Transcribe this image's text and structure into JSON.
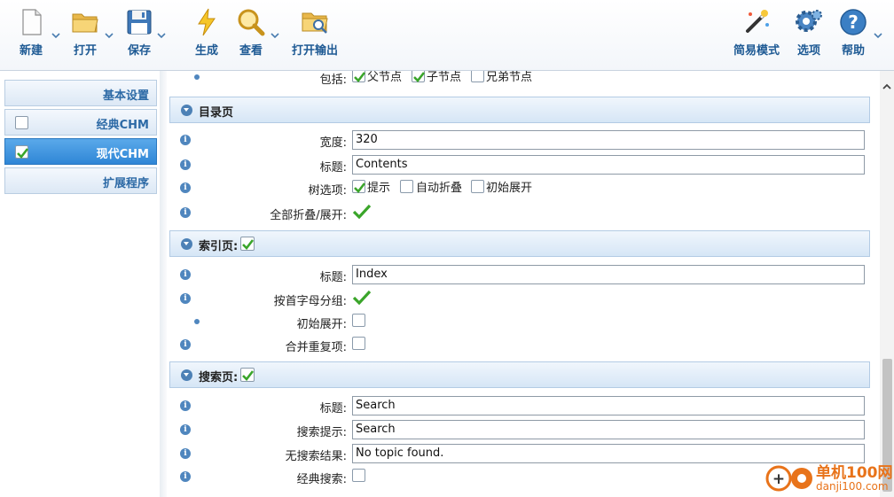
{
  "toolbar": {
    "new_label": "新建",
    "open_label": "打开",
    "save_label": "保存",
    "generate_label": "生成",
    "view_label": "查看",
    "open_output_label": "打开输出",
    "easy_mode_label": "简易模式",
    "options_label": "选项",
    "help_label": "帮助"
  },
  "sidebar": {
    "items": [
      {
        "label": "基本设置",
        "checkbox": false,
        "active": false
      },
      {
        "label": "经典CHM",
        "checkbox": true,
        "checked": false,
        "active": false
      },
      {
        "label": "现代CHM",
        "checkbox": true,
        "checked": true,
        "active": true
      },
      {
        "label": "扩展程序",
        "checkbox": false,
        "active": false
      }
    ]
  },
  "content": {
    "include_row": {
      "label": "包括:",
      "options": [
        {
          "label": "父节点",
          "checked": true
        },
        {
          "label": "子节点",
          "checked": true
        },
        {
          "label": "兄弟节点",
          "checked": false
        }
      ]
    },
    "toc_section": {
      "title": "目录页",
      "width": {
        "label": "宽度:",
        "value": "320"
      },
      "caption": {
        "label": "标题:",
        "value": "Contents"
      },
      "tree_options": {
        "label": "树选项:",
        "options": [
          {
            "label": "提示",
            "checked": true
          },
          {
            "label": "自动折叠",
            "checked": false
          },
          {
            "label": "初始展开",
            "checked": false
          }
        ]
      },
      "collapse_all": {
        "label": "全部折叠/展开:",
        "checked": true
      }
    },
    "index_section": {
      "title": "索引页:",
      "checked": true,
      "caption": {
        "label": "标题:",
        "value": "Index"
      },
      "group_by_letter": {
        "label": "按首字母分组:",
        "checked": true
      },
      "initial_expand": {
        "label": "初始展开:",
        "checked": false
      },
      "merge_duplicates": {
        "label": "合并重复项:",
        "checked": false
      }
    },
    "search_section": {
      "title": "搜索页:",
      "checked": true,
      "caption": {
        "label": "标题:",
        "value": "Search"
      },
      "search_hint": {
        "label": "搜索提示:",
        "value": "Search"
      },
      "no_results": {
        "label": "无搜索结果:",
        "value": "No topic found."
      },
      "classic_search": {
        "label": "经典搜索:",
        "checked": false
      }
    }
  },
  "watermark": {
    "line1": "单机100网",
    "line2": "danji100.com"
  },
  "colors": {
    "accent": "#2f86d6",
    "label_blue": "#1e5a94",
    "tick_green": "#3aa52a",
    "info_blue": "#4f86be"
  }
}
